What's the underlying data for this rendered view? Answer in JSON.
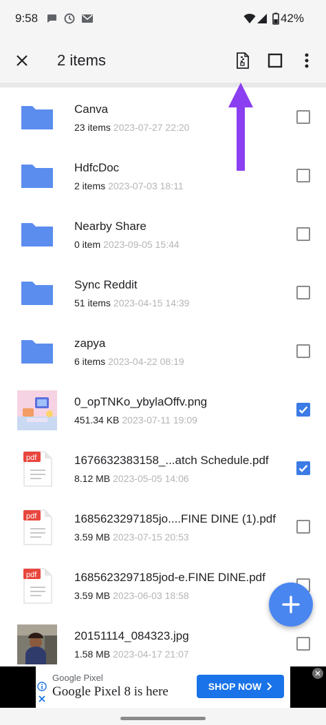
{
  "status_bar": {
    "time": "9:58",
    "battery_text": "42%",
    "icons": [
      "chat-icon",
      "clock-sync-icon",
      "mail-icon",
      "wifi-icon",
      "signal-icon",
      "battery-icon"
    ]
  },
  "app_bar": {
    "title": "2 items",
    "actions": [
      "close-icon",
      "zip-icon",
      "select-all-icon",
      "more-vert-icon"
    ]
  },
  "files": [
    {
      "name": "Canva",
      "size": "23 items",
      "date": "2023-07-27 22:20",
      "type": "folder",
      "checked": false
    },
    {
      "name": "HdfcDoc",
      "size": "2 items",
      "date": "2023-07-03 18:11",
      "type": "folder",
      "checked": false
    },
    {
      "name": "Nearby Share",
      "size": "0 item",
      "date": "2023-09-05 15:44",
      "type": "folder",
      "checked": false
    },
    {
      "name": "Sync Reddit",
      "size": "51 items",
      "date": "2023-04-15 14:39",
      "type": "folder",
      "checked": false
    },
    {
      "name": "zapya",
      "size": "6 items",
      "date": "2023-04-22 08:19",
      "type": "folder",
      "checked": false
    },
    {
      "name": "0_opTNKo_ybylaOffv.png",
      "size": "451.34 KB",
      "date": "2023-07-11 19:09",
      "type": "image",
      "checked": true
    },
    {
      "name": "1676632383158_...atch Schedule.pdf",
      "size": "8.12 MB",
      "date": "2023-05-05 14:06",
      "type": "pdf",
      "checked": true
    },
    {
      "name": "1685623297185jo....FINE DINE (1).pdf",
      "size": "3.59 MB",
      "date": "2023-07-15 20:53",
      "type": "pdf",
      "checked": false
    },
    {
      "name": "1685623297185jod-e.FINE DINE.pdf",
      "size": "3.59 MB",
      "date": "2023-06-03 18:58",
      "type": "pdf",
      "checked": false
    },
    {
      "name": "20151114_084323.jpg",
      "size": "1.58 MB",
      "date": "2023-04-17 21:07",
      "type": "photo",
      "checked": false
    }
  ],
  "pdf_badge": "pdf",
  "fab": {
    "icon": "plus-icon"
  },
  "ad": {
    "sponsor": "Google Pixel",
    "headline": "Google Pixel 8 is here",
    "cta": "SHOP NOW"
  },
  "colors": {
    "accent": "#3c7be5",
    "folder": "#5b8def",
    "pdf_red": "#e8453c",
    "annotation_arrow": "#8a3ff0"
  }
}
